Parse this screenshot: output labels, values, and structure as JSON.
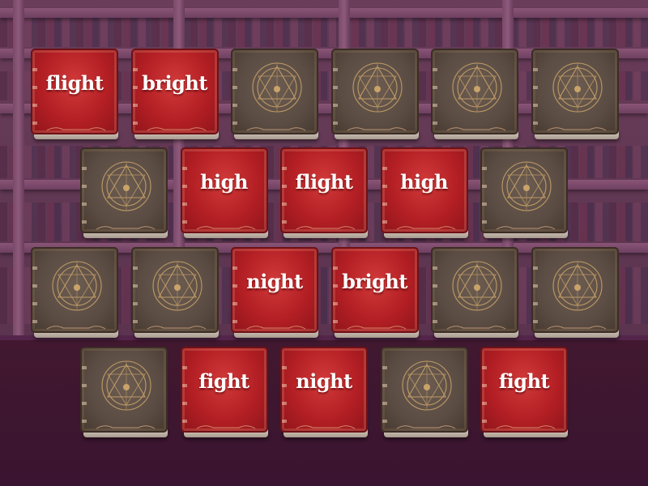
{
  "game": {
    "title": "",
    "cards": [
      {
        "row": 0,
        "col": 0,
        "state": "open",
        "word": "flight"
      },
      {
        "row": 0,
        "col": 1,
        "state": "open",
        "word": "bright"
      },
      {
        "row": 0,
        "col": 2,
        "state": "closed",
        "word": ""
      },
      {
        "row": 0,
        "col": 3,
        "state": "closed",
        "word": ""
      },
      {
        "row": 0,
        "col": 4,
        "state": "closed",
        "word": ""
      },
      {
        "row": 0,
        "col": 5,
        "state": "closed",
        "word": ""
      },
      {
        "row": 1,
        "col": 0,
        "state": "closed",
        "word": ""
      },
      {
        "row": 1,
        "col": 1,
        "state": "open",
        "word": "high"
      },
      {
        "row": 1,
        "col": 2,
        "state": "open",
        "word": "flight"
      },
      {
        "row": 1,
        "col": 3,
        "state": "open",
        "word": "high"
      },
      {
        "row": 1,
        "col": 4,
        "state": "closed",
        "word": ""
      },
      {
        "row": 2,
        "col": 0,
        "state": "closed",
        "word": ""
      },
      {
        "row": 2,
        "col": 1,
        "state": "closed",
        "word": ""
      },
      {
        "row": 2,
        "col": 2,
        "state": "open",
        "word": "night"
      },
      {
        "row": 2,
        "col": 3,
        "state": "open",
        "word": "bright"
      },
      {
        "row": 2,
        "col": 4,
        "state": "closed",
        "word": ""
      },
      {
        "row": 2,
        "col": 5,
        "state": "closed",
        "word": ""
      },
      {
        "row": 3,
        "col": 0,
        "state": "closed",
        "word": ""
      },
      {
        "row": 3,
        "col": 1,
        "state": "open",
        "word": "fight"
      },
      {
        "row": 3,
        "col": 2,
        "state": "open",
        "word": "night"
      },
      {
        "row": 3,
        "col": 3,
        "state": "closed",
        "word": ""
      },
      {
        "row": 3,
        "col": 4,
        "state": "open",
        "word": "fight"
      }
    ]
  },
  "colors": {
    "open_cover": "#b31f24",
    "closed_cover": "#5a4c43",
    "emblem_gold": "#c9a36a",
    "background": "#3a1730"
  },
  "icons": {
    "closed_card": "magic-circle-icon",
    "flourish": "ornament-icon"
  }
}
